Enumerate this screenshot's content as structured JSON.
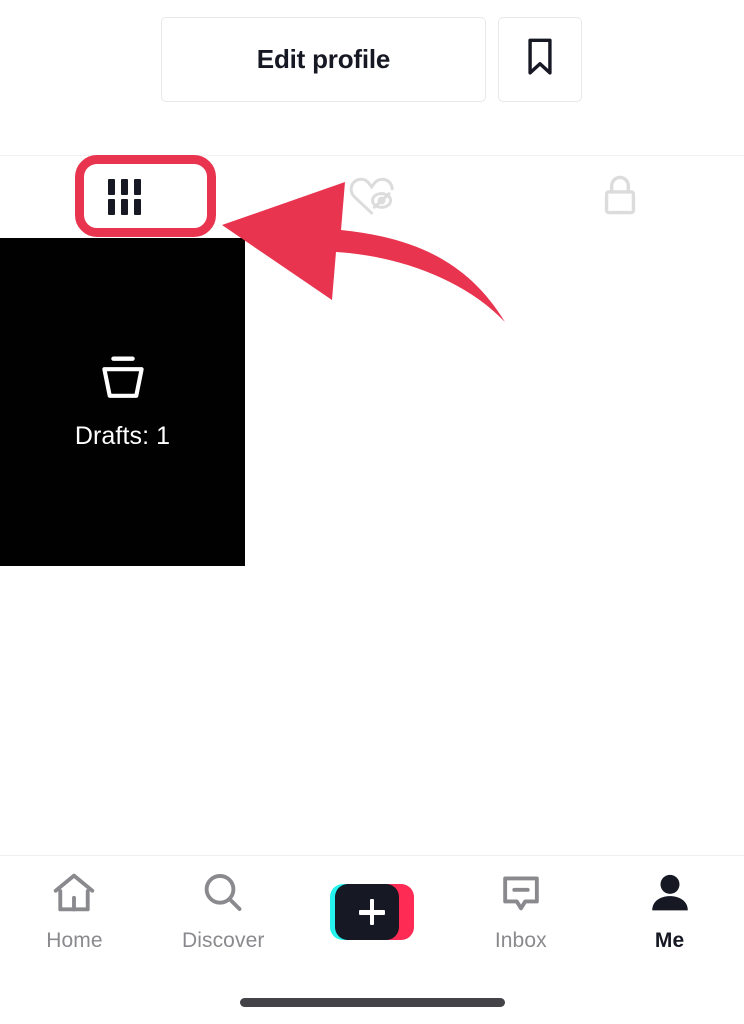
{
  "app": {
    "name": "TikTok",
    "screen": "Profile"
  },
  "profile_actions": {
    "edit_profile_label": "Edit profile",
    "edit_profile_icon": "none",
    "bookmark_icon": "bookmark-icon"
  },
  "tabs": [
    {
      "id": "posts",
      "icon": "grid-icon",
      "label": "",
      "active": true,
      "highlighted": true
    },
    {
      "id": "liked",
      "icon": "heart-hidden-icon",
      "label": "",
      "active": false,
      "highlighted": false
    },
    {
      "id": "private",
      "icon": "lock-icon",
      "label": "",
      "active": false,
      "highlighted": false
    }
  ],
  "content": {
    "drafts": {
      "label": "Drafts: 1",
      "count": 1,
      "icon": "drafts-tray-icon",
      "background_color": "#010101"
    }
  },
  "annotation": {
    "type": "arrow-and-highlight",
    "color": "#e8344e",
    "points_to": "posts-tab",
    "arrow_direction": "left"
  },
  "bottom_nav": {
    "items": [
      {
        "id": "home",
        "label": "Home",
        "icon": "home-icon",
        "active": false
      },
      {
        "id": "discover",
        "label": "Discover",
        "icon": "search-icon",
        "active": false
      },
      {
        "id": "create",
        "label": "",
        "icon": "plus-icon",
        "active": false
      },
      {
        "id": "inbox",
        "label": "Inbox",
        "icon": "message-icon",
        "active": false
      },
      {
        "id": "me",
        "label": "Me",
        "icon": "person-icon",
        "active": true
      }
    ]
  },
  "system": {
    "home_indicator": true
  },
  "colors": {
    "accent_red": "#e8344e",
    "tiktok_pink": "#fe2c55",
    "tiktok_cyan": "#25f4ee",
    "text_primary": "#161823",
    "text_muted": "#8a8a8e",
    "border": "#e8e8ea"
  }
}
